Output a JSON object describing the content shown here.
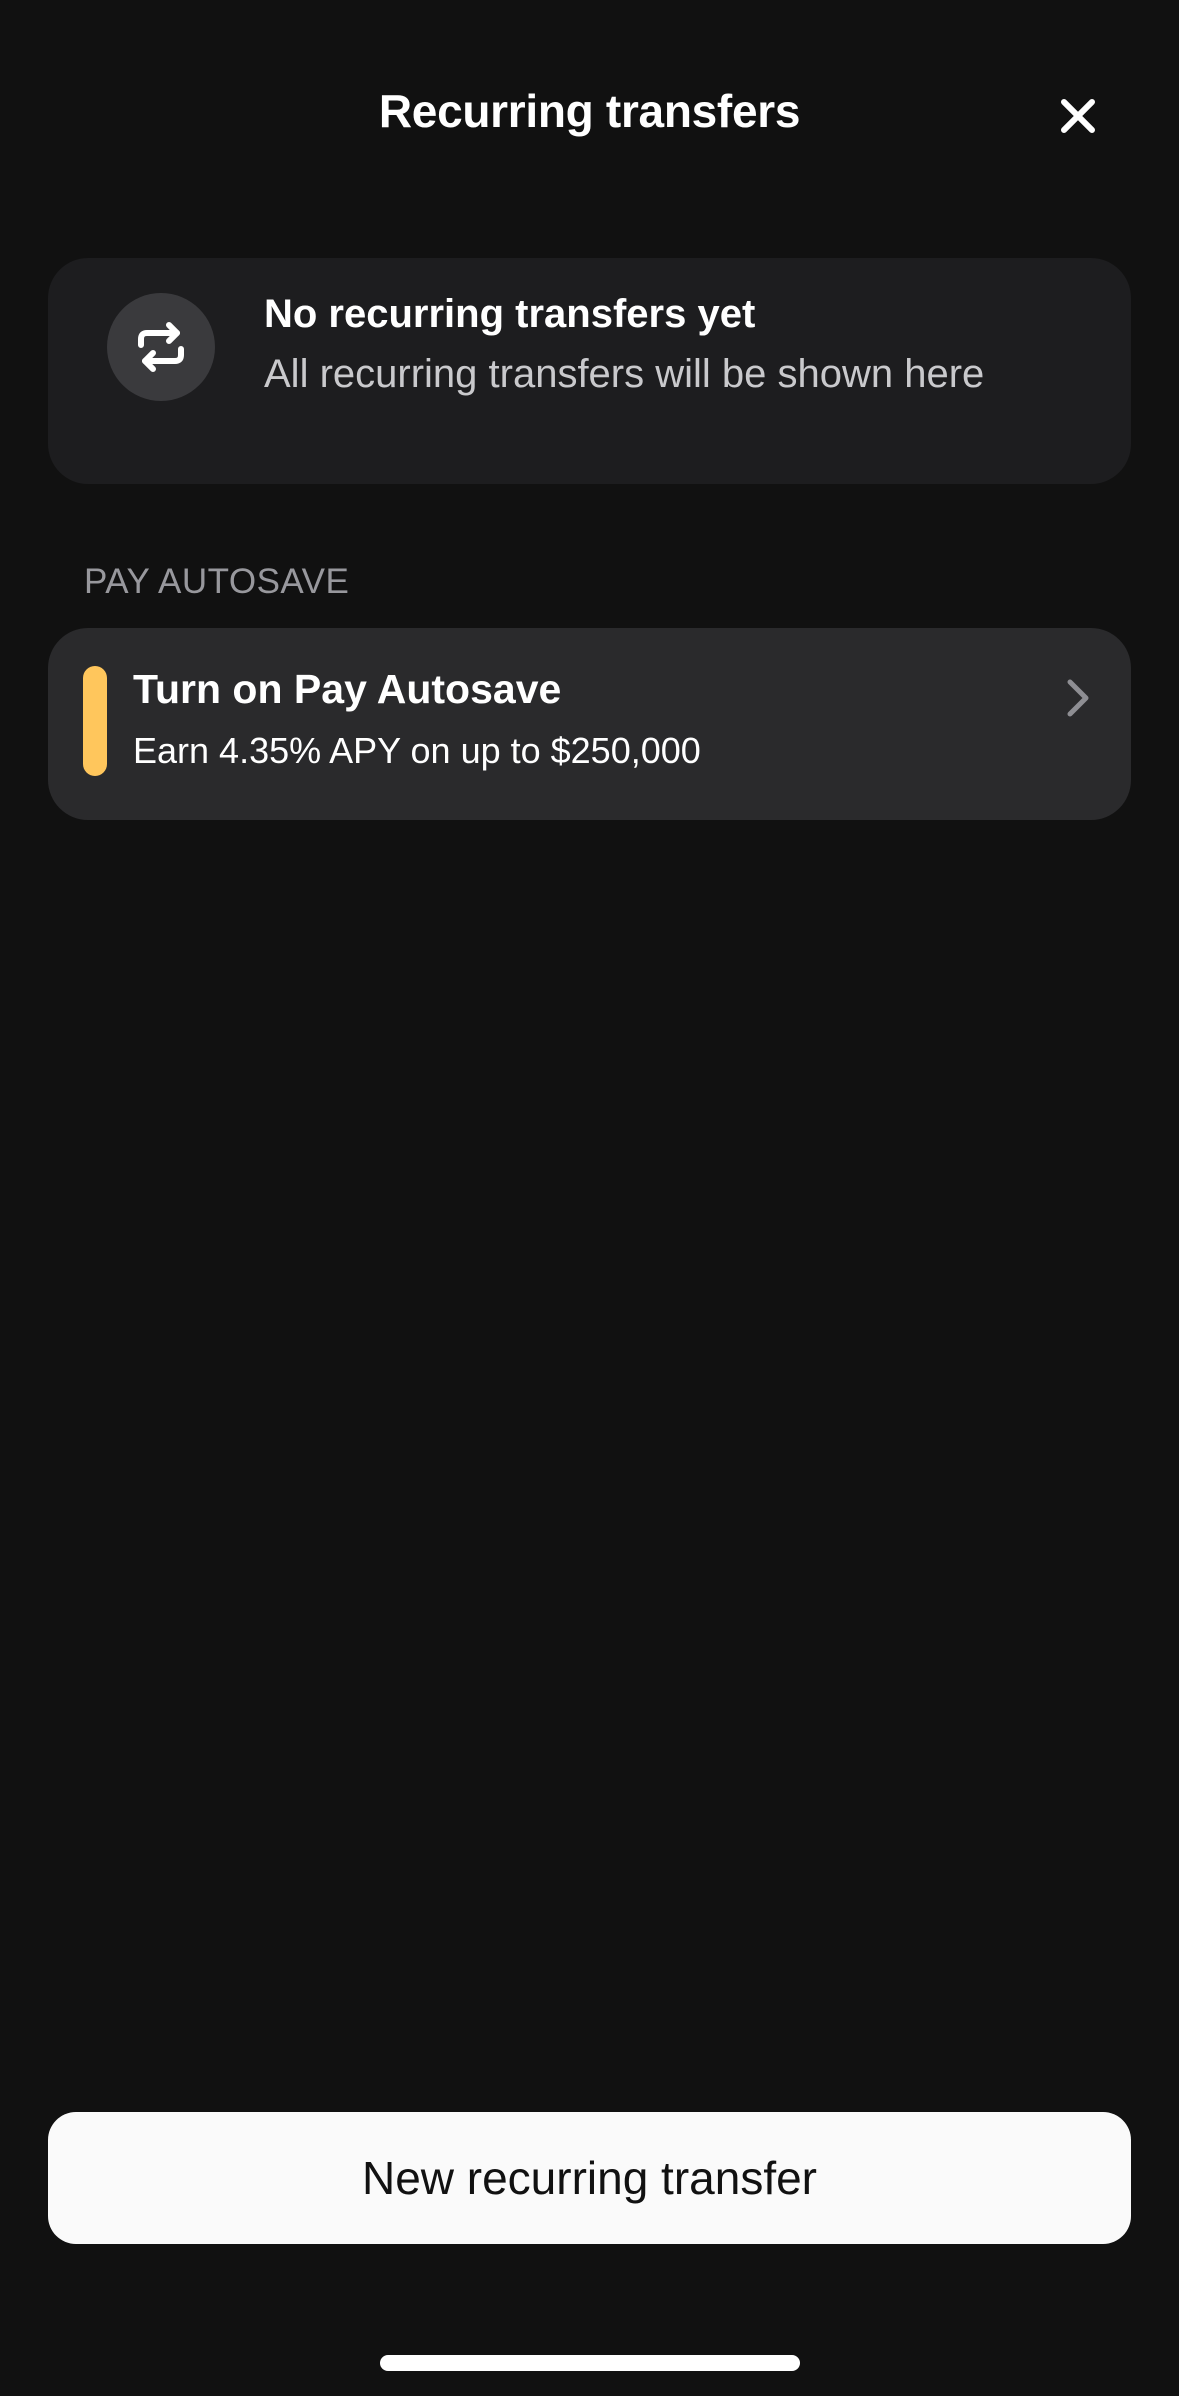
{
  "header": {
    "title": "Recurring transfers",
    "close_icon": "close-icon"
  },
  "empty_state": {
    "icon": "repeat-icon",
    "title": "No recurring transfers yet",
    "subtitle": "All recurring transfers will be shown here"
  },
  "pay_autosave": {
    "section_label": "PAY AUTOSAVE",
    "title": "Turn on Pay Autosave",
    "subtitle": "Earn 4.35% APY on up to $250,000",
    "accent_color": "#ffc65c",
    "chevron_icon": "chevron-right-icon"
  },
  "footer": {
    "new_button_label": "New recurring transfer"
  },
  "colors": {
    "background": "#111111",
    "card": "#1d1d1f",
    "card_elevated": "#2a2a2c",
    "button": "#fafafa"
  }
}
